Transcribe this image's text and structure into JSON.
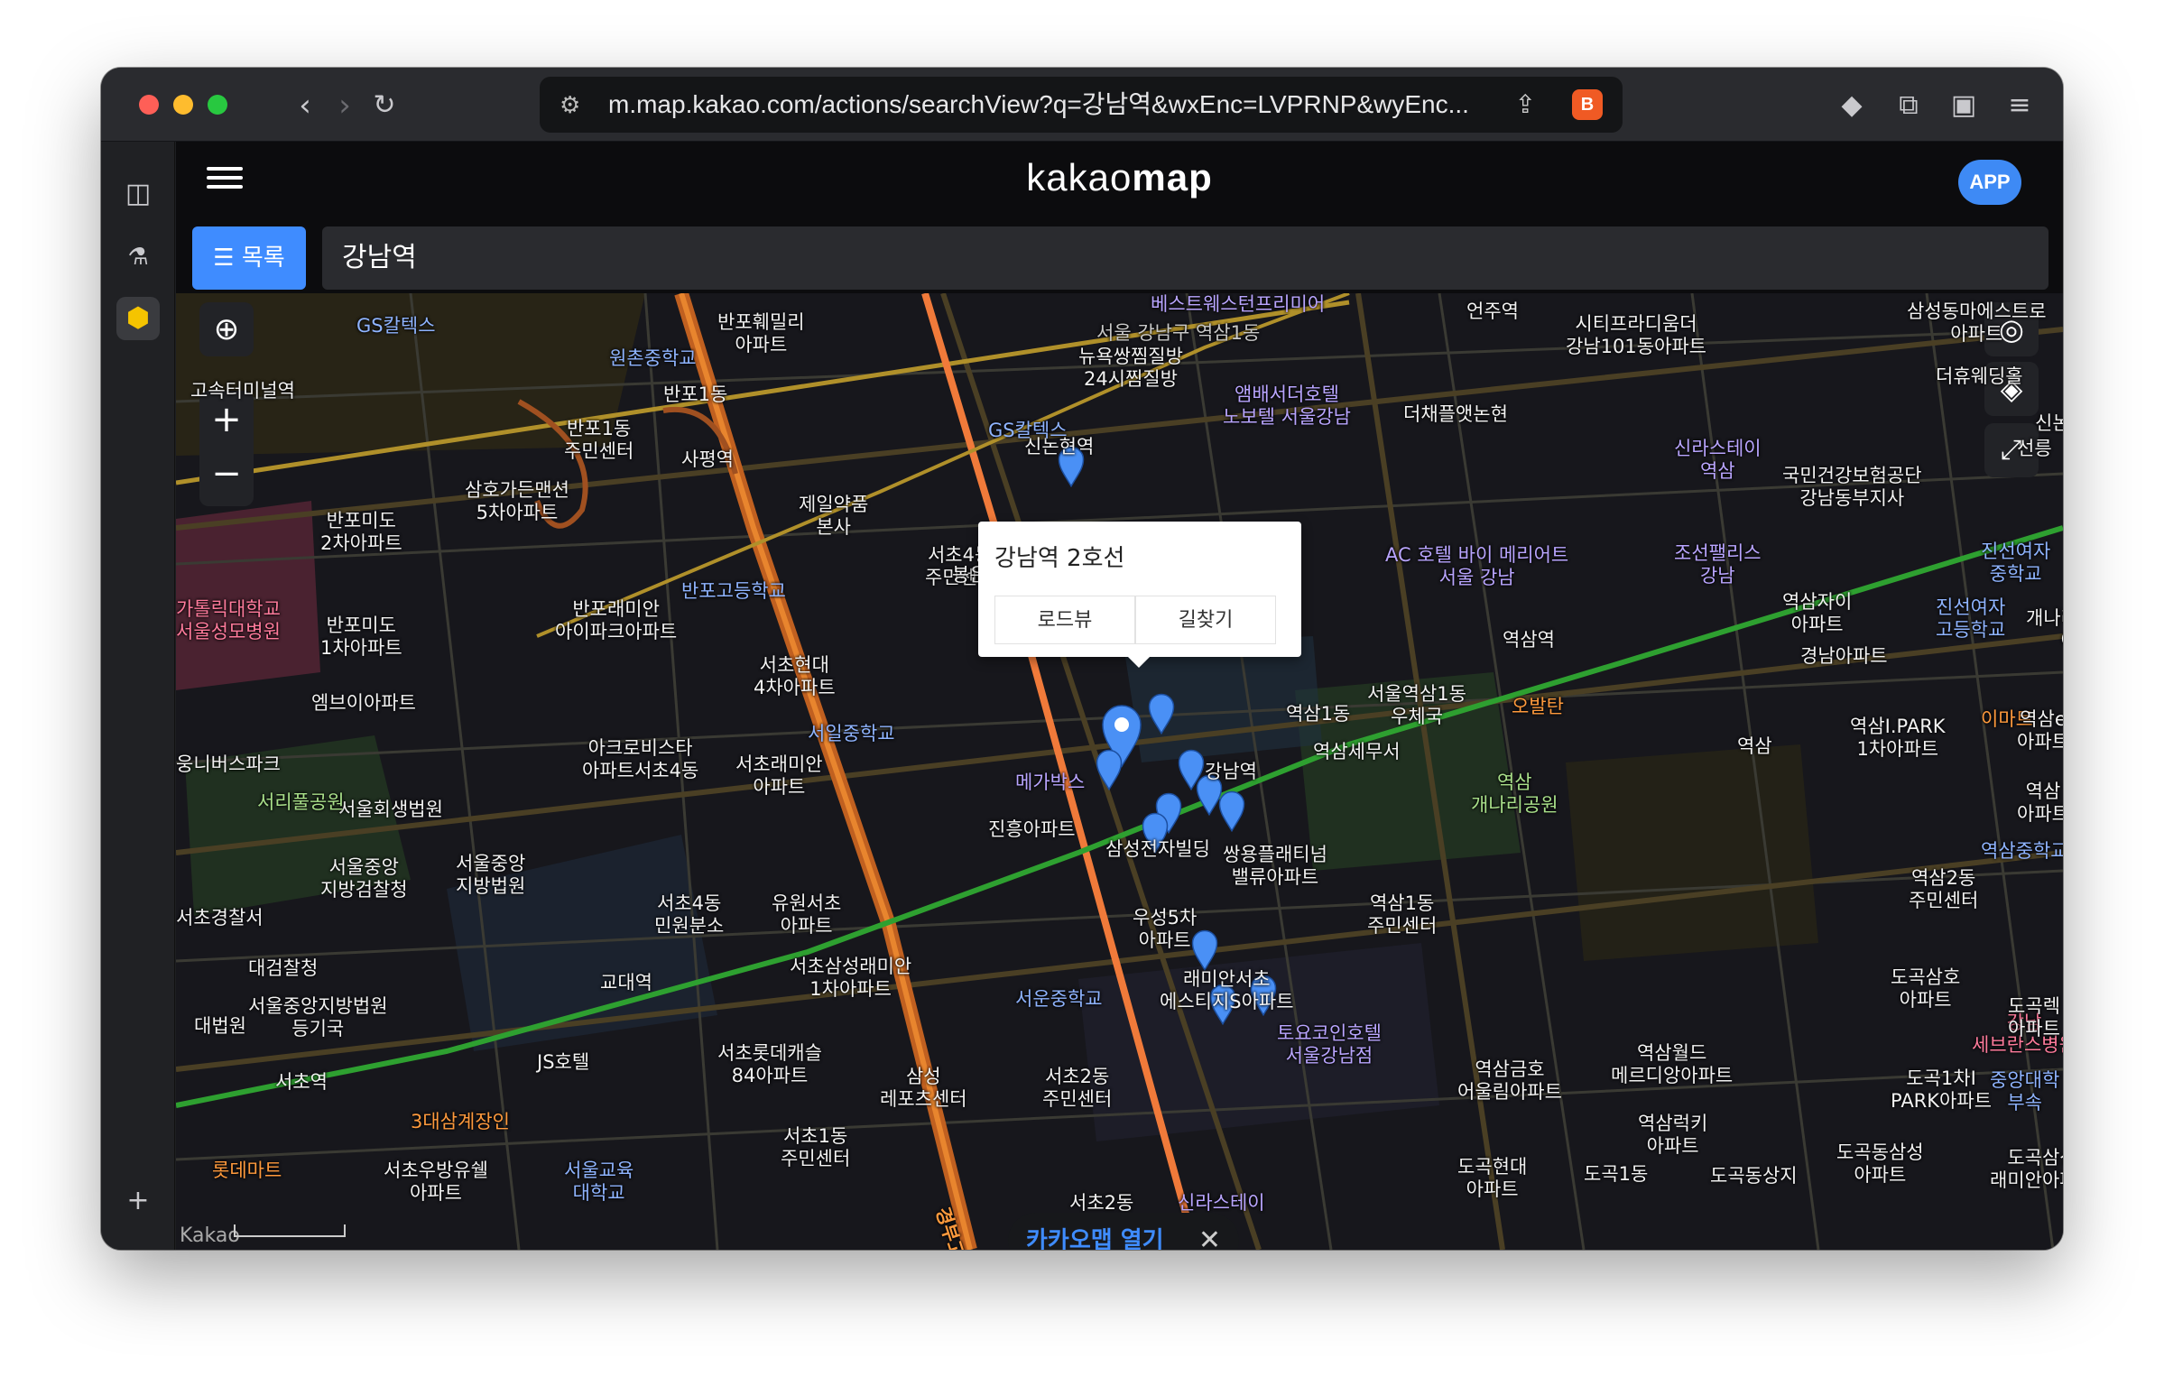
{
  "browser": {
    "url": "m.map.kakao.com/actions/searchView?q=강남역&wxEnc=LVPRNP&wyEnc...",
    "icons": [
      "sidebar-toggle-icon",
      "back-icon",
      "forward-icon",
      "reload-icon",
      "site-settings-icon",
      "share-icon",
      "brave-shields-icon",
      "wallet-icon",
      "extensions-icon",
      "split-view-icon",
      "menu-icon"
    ]
  },
  "app": {
    "logo_light": "kakao",
    "logo_bold": "map",
    "app_button": "APP",
    "list_button": "☰ 목록",
    "search_value": "강남역",
    "accent_color": "#3f8cff"
  },
  "popup": {
    "title": "강남역 2호선",
    "roadview": "로드뷰",
    "directions": "길찾기"
  },
  "open_bar": {
    "label": "카카오맵 열기",
    "close": "✕"
  },
  "map": {
    "copyright": "Kakao",
    "labels": [
      {
        "text": "GS칼텍스",
        "cls": "blue"
      },
      {
        "text": "원촌중학교",
        "cls": "blue"
      },
      {
        "text": "반포훼밀리\n아파트",
        "cls": ""
      },
      {
        "text": "반포1동",
        "cls": ""
      },
      {
        "text": "반포1동\n주민센터",
        "cls": ""
      },
      {
        "text": "사평역",
        "cls": ""
      },
      {
        "text": "고속터미널역",
        "cls": ""
      },
      {
        "text": "삼호가든맨션\n5차아파트",
        "cls": ""
      },
      {
        "text": "반포미도\n2차아파트",
        "cls": ""
      },
      {
        "text": "반포고등학교",
        "cls": "blue"
      },
      {
        "text": "반포래미안\n아이파크아파트",
        "cls": ""
      },
      {
        "text": "반포미도\n1차아파트",
        "cls": ""
      },
      {
        "text": "엠브이아파트",
        "cls": ""
      },
      {
        "text": "제일약품\n본사",
        "cls": ""
      },
      {
        "text": "서초4동\n주민센터",
        "cls": ""
      },
      {
        "text": "서초현대\n4차아파트",
        "cls": ""
      },
      {
        "text": "아크로비스타\n아파트서초4동",
        "cls": ""
      },
      {
        "text": "서초래미안\n아파트",
        "cls": ""
      },
      {
        "text": "서일중학교",
        "cls": "blue"
      },
      {
        "text": "봉은사로",
        "cls": ""
      },
      {
        "text": "신논현역",
        "cls": ""
      },
      {
        "text": "GS칼텍스",
        "cls": "blue"
      },
      {
        "text": "서울 강남구 역삼1동",
        "cls": "gray"
      },
      {
        "text": "베스트웨스턴프리미어",
        "cls": "purple"
      },
      {
        "text": "뉴욕쌍찜질방\n24시찜질방",
        "cls": ""
      },
      {
        "text": "앰배서더호텔\n노보텔 서울강남",
        "cls": "purple"
      },
      {
        "text": "더채플앳논현",
        "cls": ""
      },
      {
        "text": "언주역",
        "cls": ""
      },
      {
        "text": "시티프라디움더\n강남101동아파트",
        "cls": ""
      },
      {
        "text": "신라스테이\n역삼",
        "cls": "purple"
      },
      {
        "text": "삼성동마에스트로\n아파트",
        "cls": ""
      },
      {
        "text": "더휴웨딩홀",
        "cls": ""
      },
      {
        "text": "국민건강보험공단\n강남동부지사",
        "cls": ""
      },
      {
        "text": "AC 호텔 바이 메리어트\n서울 강남",
        "cls": "purple"
      },
      {
        "text": "조선팰리스\n강남",
        "cls": "purple"
      },
      {
        "text": "역삼자이\n아파트",
        "cls": ""
      },
      {
        "text": "진선여자\n고등학교",
        "cls": "blue"
      },
      {
        "text": "진선여자\n중학교",
        "cls": "blue"
      },
      {
        "text": "개나리푸르지오\n아파트",
        "cls": ""
      },
      {
        "text": "역삼역",
        "cls": ""
      },
      {
        "text": "경남아파트",
        "cls": ""
      },
      {
        "text": "서울역삼1동\n우체국",
        "cls": ""
      },
      {
        "text": "역삼1동",
        "cls": ""
      },
      {
        "text": "역삼세무서",
        "cls": ""
      },
      {
        "text": "오발탄",
        "cls": "orange"
      },
      {
        "text": "역삼I.PARK\n1차아파트",
        "cls": ""
      },
      {
        "text": "이마트",
        "cls": "orange"
      },
      {
        "text": "역삼",
        "cls": ""
      },
      {
        "text": "역삼\n개나리공원",
        "cls": "green"
      },
      {
        "text": "강남역",
        "cls": ""
      },
      {
        "text": "메가박스",
        "cls": "purple"
      },
      {
        "text": "삼성전자빌딩",
        "cls": ""
      },
      {
        "text": "진흥아파트",
        "cls": ""
      },
      {
        "text": "쌍용플래티넘\n밸류아파트",
        "cls": ""
      },
      {
        "text": "역삼1동\n주민센터",
        "cls": ""
      },
      {
        "text": "역삼2동\n주민센터",
        "cls": ""
      },
      {
        "text": "역삼중학교",
        "cls": "blue"
      },
      {
        "text": "우성5차\n아파트",
        "cls": ""
      },
      {
        "text": "래미안서초\n에스티지S아파트",
        "cls": ""
      },
      {
        "text": "토요코인호텔\n서울강남점",
        "cls": "purple"
      },
      {
        "text": "역삼월드\n메르디앙아파트",
        "cls": ""
      },
      {
        "text": "도곡삼호\n아파트",
        "cls": ""
      },
      {
        "text": "강남\n세브란스병원",
        "cls": "pink"
      },
      {
        "text": "도곡1차I\nPARK아파트",
        "cls": ""
      },
      {
        "text": "역삼금호\n어울림아파트",
        "cls": ""
      },
      {
        "text": "서운중학교",
        "cls": "blue"
      },
      {
        "text": "서초2동\n주민센터",
        "cls": ""
      },
      {
        "text": "서초삼성래미안\n1차아파트",
        "cls": ""
      },
      {
        "text": "유원서초\n아파트",
        "cls": ""
      },
      {
        "text": "서초4동\n민원분소",
        "cls": ""
      },
      {
        "text": "서울중앙\n지방검찰청",
        "cls": ""
      },
      {
        "text": "서울중앙\n지방법원",
        "cls": ""
      },
      {
        "text": "서울회생법원",
        "cls": ""
      },
      {
        "text": "서리풀공원",
        "cls": "green"
      },
      {
        "text": "대검찰청",
        "cls": ""
      },
      {
        "text": "교대역",
        "cls": ""
      },
      {
        "text": "서울중앙지방법원\n등기국",
        "cls": ""
      },
      {
        "text": "대법원",
        "cls": ""
      },
      {
        "text": "서초역",
        "cls": ""
      },
      {
        "text": "JS호텔",
        "cls": ""
      },
      {
        "text": "서초롯데캐슬\n84아파트",
        "cls": ""
      },
      {
        "text": "삼성\n레포츠센터",
        "cls": ""
      },
      {
        "text": "3대삼계장인",
        "cls": "orange"
      },
      {
        "text": "롯데마트",
        "cls": "orange"
      },
      {
        "text": "서초우방유쉘\n아파트",
        "cls": ""
      },
      {
        "text": "서울교육\n대학교",
        "cls": "blue"
      },
      {
        "text": "서초1동\n주민센터",
        "cls": ""
      },
      {
        "text": "서초2동",
        "cls": ""
      },
      {
        "text": "신라스테이",
        "cls": "purple"
      },
      {
        "text": "도곡현대\n아파트",
        "cls": ""
      },
      {
        "text": "도곡1동",
        "cls": ""
      },
      {
        "text": "도곡동상지",
        "cls": ""
      },
      {
        "text": "역삼럭키\n아파트",
        "cls": ""
      },
      {
        "text": "도곡동삼성\n아파트",
        "cls": ""
      },
      {
        "text": "도곡삼성\n래미안아파트",
        "cls": ""
      },
      {
        "text": "서초경찰서",
        "cls": ""
      },
      {
        "text": "웅니버스파크",
        "cls": ""
      },
      {
        "text": "가톨릭대학교\n서울성모병원",
        "cls": "pink"
      },
      {
        "text": "신논현",
        "cls": ""
      },
      {
        "text": "경부고속도로",
        "cls": "road"
      },
      {
        "text": "도곡렉\n아파트",
        "cls": ""
      },
      {
        "text": "중앙대학\n부속",
        "cls": "blue"
      },
      {
        "text": "역삼e\n아파트",
        "cls": ""
      },
      {
        "text": "역삼\n아파트",
        "cls": ""
      },
      {
        "text": "선릉",
        "cls": ""
      }
    ]
  }
}
